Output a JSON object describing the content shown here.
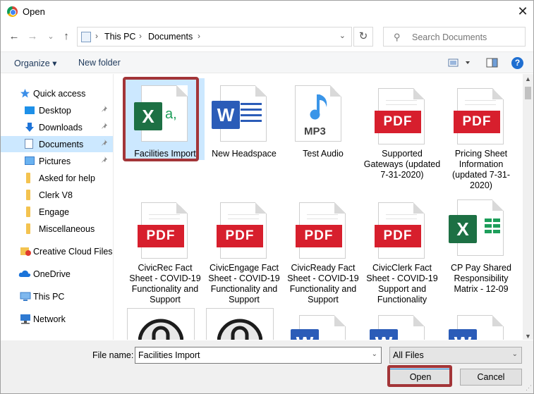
{
  "window": {
    "title": "Open",
    "close_label": "✕"
  },
  "nav": {
    "back": "←",
    "forward": "→",
    "recent": "⌄",
    "up": "↑"
  },
  "address": {
    "segments": [
      "This PC",
      "Documents"
    ],
    "refresh": "↻"
  },
  "search": {
    "placeholder": "Search Documents"
  },
  "toolbar": {
    "organize": "Organize ▾",
    "new_folder": "New folder",
    "help": "?"
  },
  "sidebar": {
    "items": [
      {
        "label": "Quick access",
        "icon": "star-icon"
      },
      {
        "label": "Desktop",
        "icon": "desktop-icon",
        "pinned": true
      },
      {
        "label": "Downloads",
        "icon": "download-icon",
        "pinned": true
      },
      {
        "label": "Documents",
        "icon": "documents-icon",
        "pinned": true,
        "selected": true
      },
      {
        "label": "Pictures",
        "icon": "pictures-icon",
        "pinned": true
      },
      {
        "label": "Asked for help",
        "icon": "folder-icon"
      },
      {
        "label": "Clerk V8",
        "icon": "folder-icon"
      },
      {
        "label": "Engage",
        "icon": "folder-icon"
      },
      {
        "label": "Miscellaneous",
        "icon": "folder-icon"
      },
      {
        "label": "Creative Cloud Files",
        "icon": "creative-cloud-icon"
      },
      {
        "label": "OneDrive",
        "icon": "onedrive-icon"
      },
      {
        "label": "This PC",
        "icon": "this-pc-icon"
      },
      {
        "label": "Network",
        "icon": "network-icon"
      }
    ],
    "pin_glyph": "📌"
  },
  "files": [
    {
      "name": "Facilities Import",
      "type": "excel-csv",
      "selected": true
    },
    {
      "name": "New Headspace",
      "type": "word"
    },
    {
      "name": "Test Audio",
      "type": "mp3"
    },
    {
      "name": "Supported Gateways (updated 7-31-2020)",
      "type": "pdf"
    },
    {
      "name": "Pricing Sheet Information (updated 7-31-2020)",
      "type": "pdf"
    },
    {
      "name": "CivicRec Fact Sheet - COVID-19 Functionality and Support",
      "type": "pdf"
    },
    {
      "name": "CivicEngage Fact Sheet - COVID-19 Functionality and Support",
      "type": "pdf"
    },
    {
      "name": "CivicReady Fact Sheet - COVID-19 Functionality and Support",
      "type": "pdf"
    },
    {
      "name": "CivicClerk Fact Sheet - COVID-19 Support and Functionality",
      "type": "pdf"
    },
    {
      "name": "CP Pay Shared Responsibility Matrix - 12-09",
      "type": "excel"
    }
  ],
  "badges": {
    "pdf": "PDF",
    "mp3": "MP3",
    "excel": "X",
    "word": "W",
    "csv_a": "a,"
  },
  "bottom": {
    "file_name_label": "File name:",
    "file_name_value": "Facilities Import",
    "filter_value": "All Files",
    "open_label": "Open",
    "cancel_label": "Cancel"
  },
  "colors": {
    "selection": "#cce8ff",
    "highlight_outline": "#a33538",
    "pdf_red": "#d71f2d",
    "excel_green": "#1d7044",
    "word_blue": "#2b5cb8"
  }
}
